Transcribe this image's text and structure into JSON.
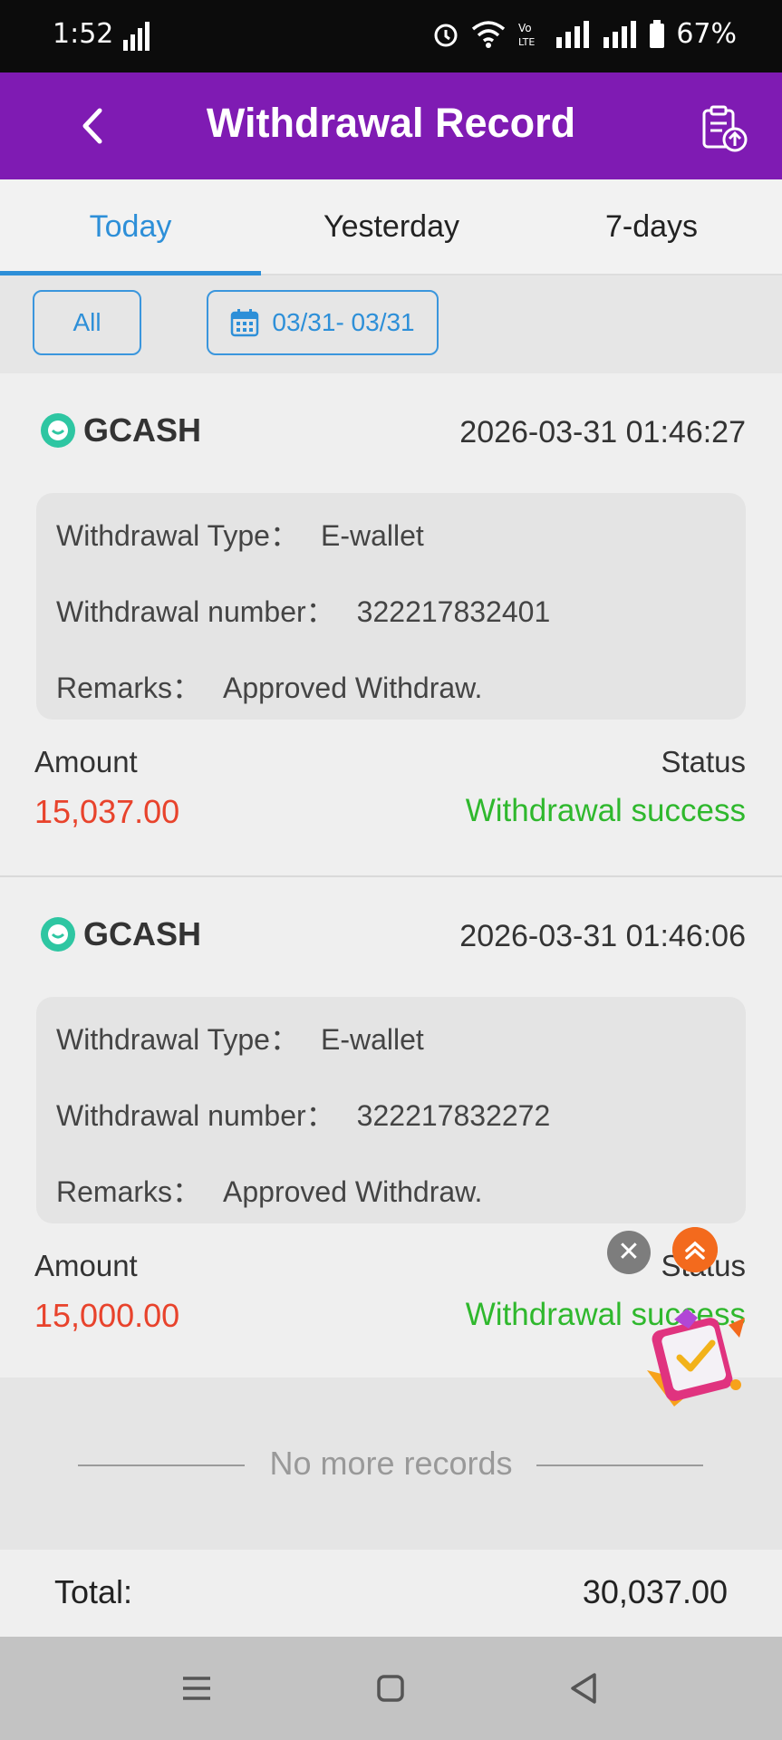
{
  "status_bar": {
    "time": "1:52",
    "battery": "67%"
  },
  "header": {
    "title": "Withdrawal Record"
  },
  "tabs": [
    {
      "label": "Today",
      "active": true
    },
    {
      "label": "Yesterday",
      "active": false
    },
    {
      "label": "7-days",
      "active": false
    }
  ],
  "filters": {
    "all_label": "All",
    "date_range": "03/31- 03/31"
  },
  "records": [
    {
      "method": "GCASH",
      "datetime": "2026-03-31 01:46:27",
      "type_label": "Withdrawal Type：",
      "type_value": "E-wallet",
      "number_label": "Withdrawal number：",
      "number_value": "322217832401",
      "remarks_label": "Remarks：",
      "remarks_value": "Approved Withdraw.",
      "amount_label": "Amount",
      "amount_value": "15,037.00",
      "status_label": "Status",
      "status_value": "Withdrawal success"
    },
    {
      "method": "GCASH",
      "datetime": "2026-03-31 01:46:06",
      "type_label": "Withdrawal Type：",
      "type_value": "E-wallet",
      "number_label": "Withdrawal number：",
      "number_value": "322217832272",
      "remarks_label": "Remarks：",
      "remarks_value": "Approved Withdraw.",
      "amount_label": "Amount",
      "amount_value": "15,000.00",
      "status_label": "Status",
      "status_value": "Withdrawal success"
    }
  ],
  "no_more_text": "No more records",
  "total": {
    "label": "Total:",
    "value": "30,037.00"
  },
  "colors": {
    "header_bg": "#7f1bb3",
    "accent": "#2d8fd8",
    "amount": "#e8432c",
    "success": "#2fb82d"
  }
}
